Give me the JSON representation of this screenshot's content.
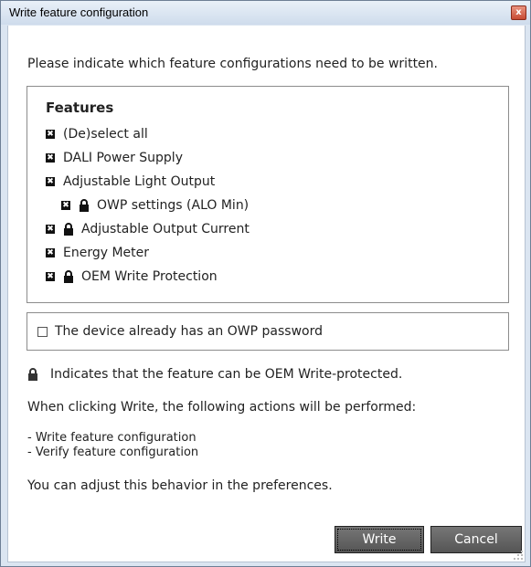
{
  "window": {
    "title": "Write feature configuration",
    "close_glyph": "x"
  },
  "intro_text": "Please indicate which feature configurations need to be written.",
  "features": {
    "heading": "Features",
    "items": [
      {
        "label": "(De)select all",
        "checked": true,
        "locked": false
      },
      {
        "label": "DALI Power Supply",
        "checked": true,
        "locked": false
      },
      {
        "label": "Adjustable Light Output",
        "checked": true,
        "locked": false
      },
      {
        "label": "OWP settings (ALO Min)",
        "checked": true,
        "locked": true
      },
      {
        "label": "Adjustable Output Current",
        "checked": true,
        "locked": true
      },
      {
        "label": "Energy Meter",
        "checked": true,
        "locked": false
      },
      {
        "label": "OEM Write Protection",
        "checked": true,
        "locked": true
      }
    ]
  },
  "owp_password": {
    "label": "The device already has an OWP password",
    "checked": false
  },
  "lock_note": "Indicates that the feature can be OEM Write-protected.",
  "actions_intro": "When clicking Write, the following actions will be performed:",
  "actions": [
    "- Write feature configuration",
    "- Verify feature configuration"
  ],
  "preferences_note": "You can adjust this behavior in the preferences.",
  "buttons": {
    "write": "Write",
    "cancel": "Cancel"
  },
  "colors": {
    "button_bg": "#606060",
    "close_btn": "#c74a33",
    "title_bar": "#dbe5f1"
  },
  "icons": {
    "check": "check-mark-icon",
    "lock": "padlock-icon"
  }
}
